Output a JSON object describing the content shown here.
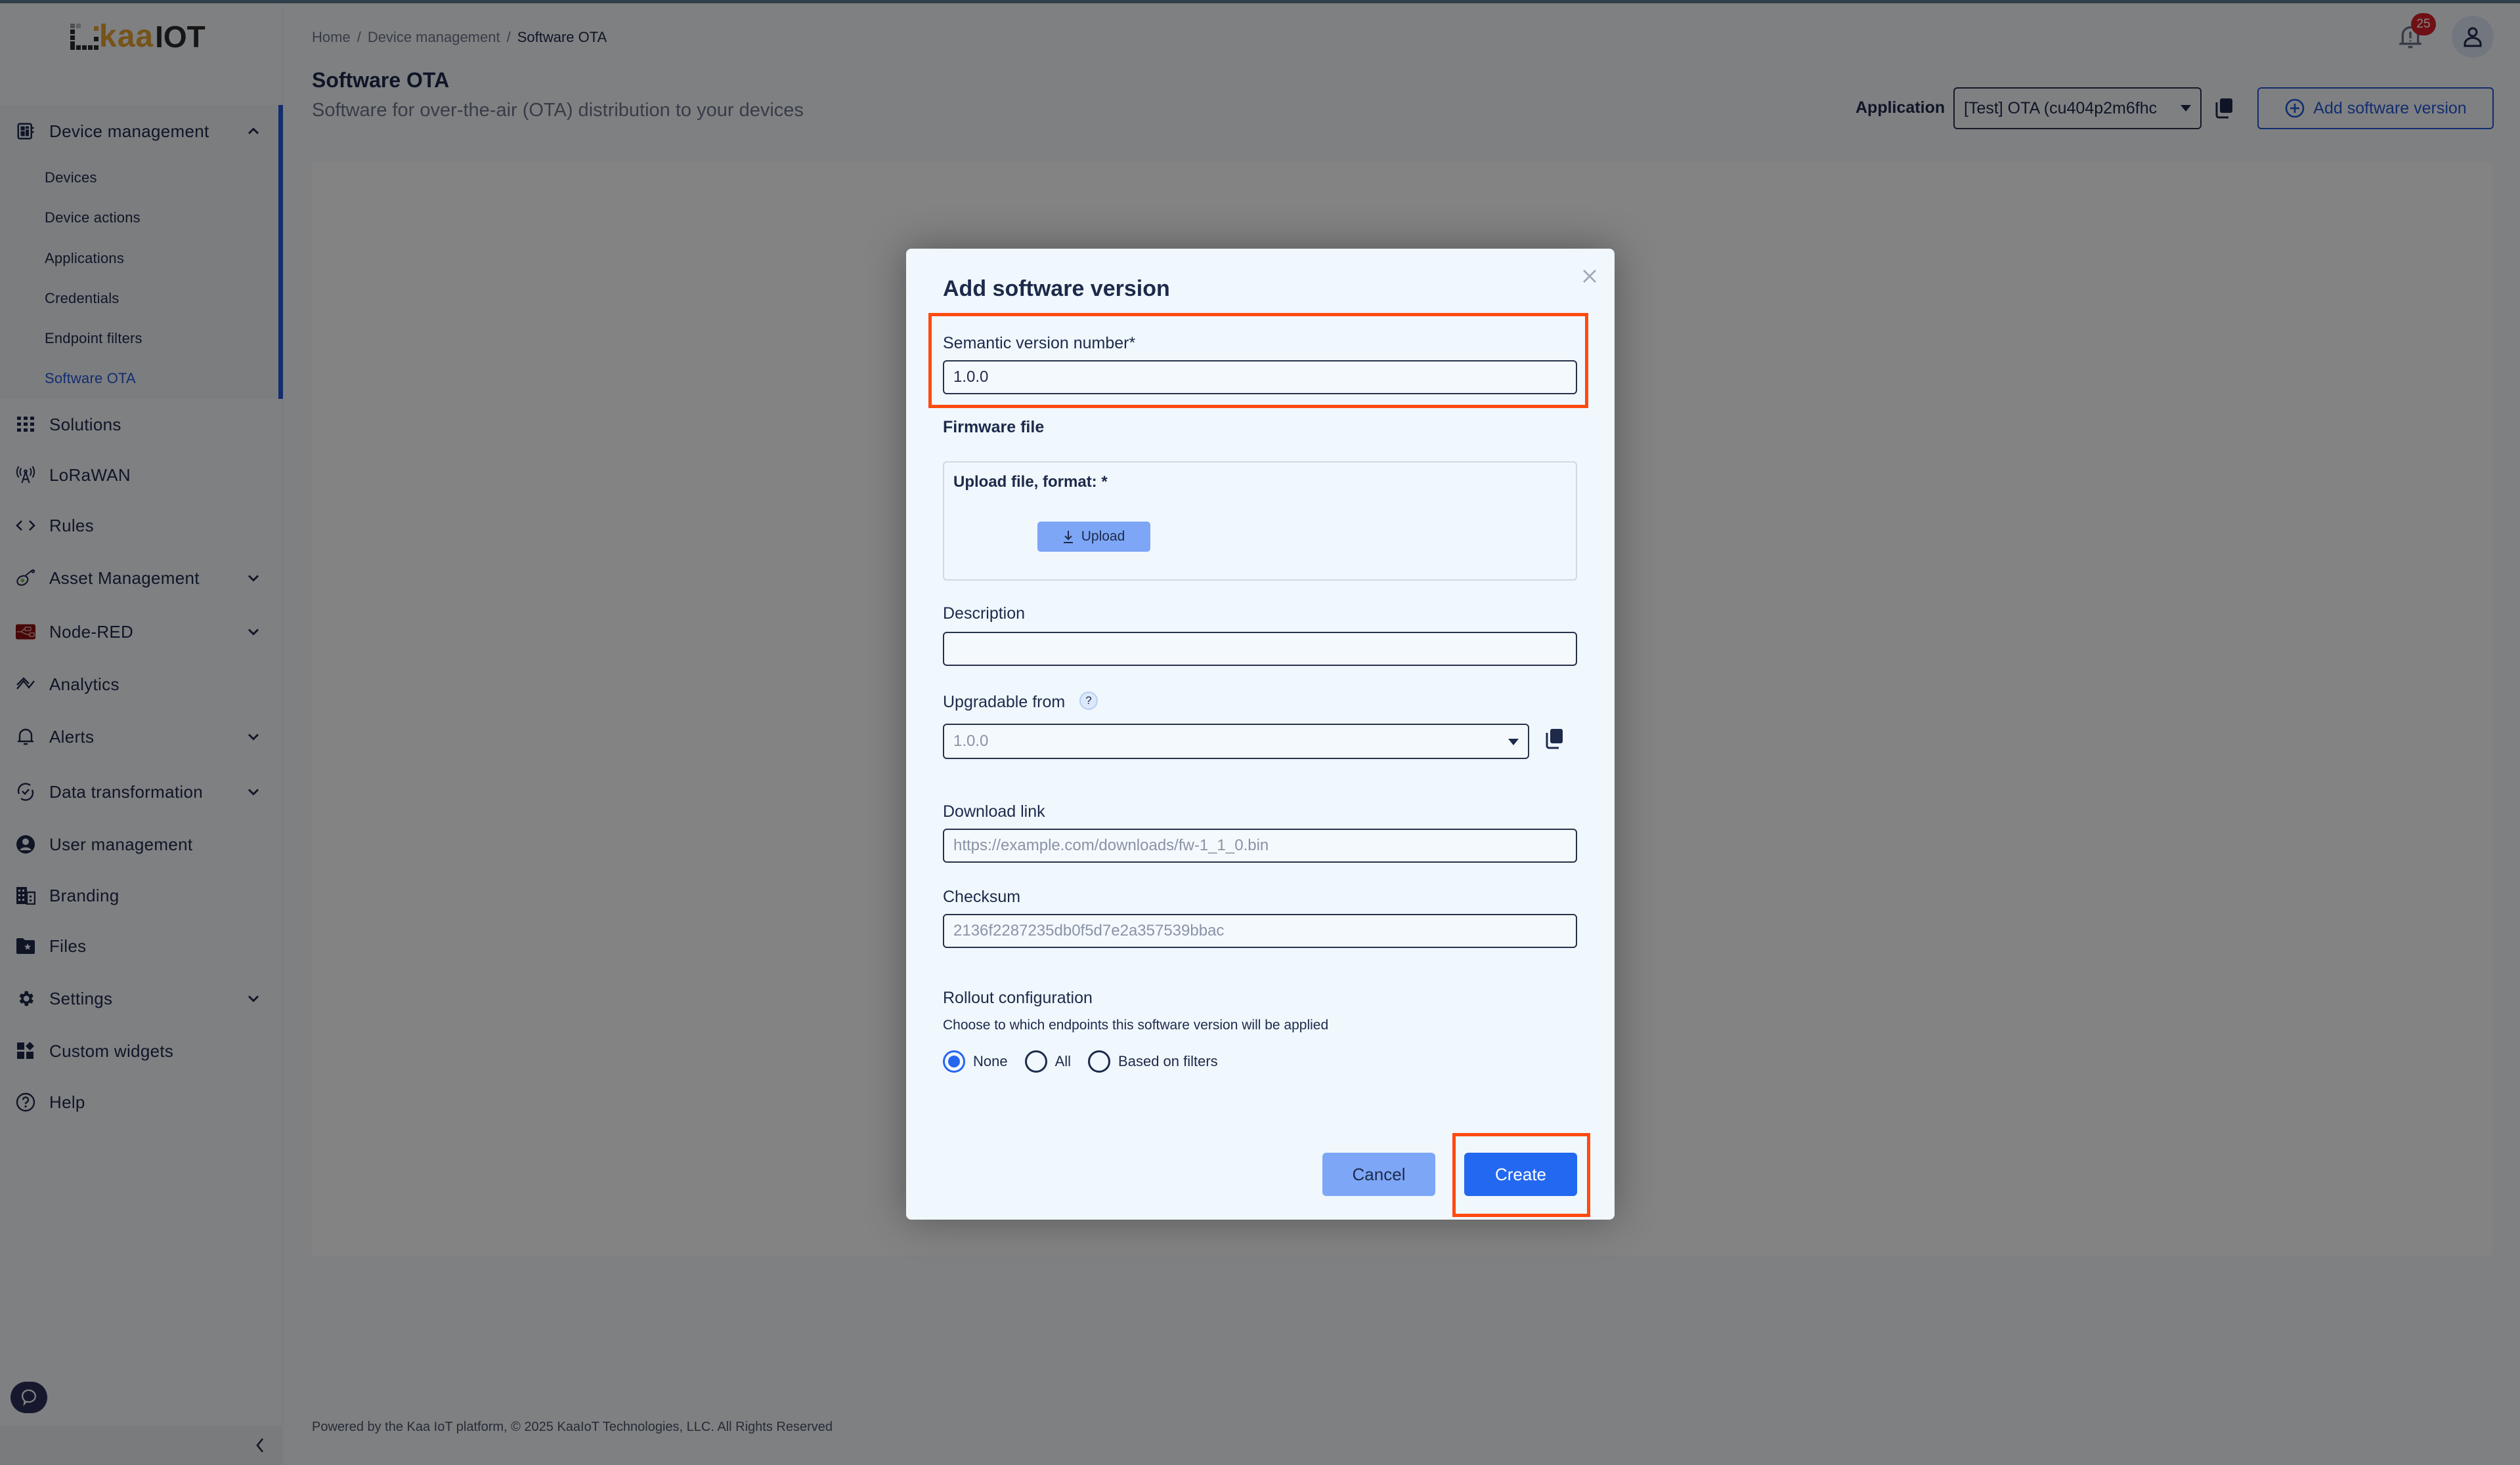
{
  "logo": {
    "brand_kaa": "kaa",
    "brand_iot": "IOT"
  },
  "sidebar": {
    "group": {
      "label": "Device management",
      "icon": "chip-icon",
      "expanded": true,
      "items": [
        {
          "label": "Devices",
          "active": false
        },
        {
          "label": "Device actions",
          "active": false
        },
        {
          "label": "Applications",
          "active": false
        },
        {
          "label": "Credentials",
          "active": false
        },
        {
          "label": "Endpoint filters",
          "active": false
        },
        {
          "label": "Software OTA",
          "active": true
        }
      ]
    },
    "items": [
      {
        "label": "Solutions",
        "icon": "grid-icon",
        "expandable": false
      },
      {
        "label": "LoRaWAN",
        "icon": "antenna-icon",
        "expandable": false
      },
      {
        "label": "Rules",
        "icon": "code-icon",
        "expandable": false
      },
      {
        "label": "Asset Management",
        "icon": "tag-icon",
        "expandable": true
      },
      {
        "label": "Node-RED",
        "icon": "node-red-icon",
        "expandable": true
      },
      {
        "label": "Analytics",
        "icon": "analytics-icon",
        "expandable": false
      },
      {
        "label": "Alerts",
        "icon": "bell-icon",
        "expandable": true
      },
      {
        "label": "Data transformation",
        "icon": "transform-icon",
        "expandable": true
      },
      {
        "label": "User management",
        "icon": "user-circle-icon",
        "expandable": false
      },
      {
        "label": "Branding",
        "icon": "building-icon",
        "expandable": false
      },
      {
        "label": "Files",
        "icon": "folder-star-icon",
        "expandable": false
      },
      {
        "label": "Settings",
        "icon": "gear-icon",
        "expandable": true
      },
      {
        "label": "Custom widgets",
        "icon": "widgets-icon",
        "expandable": false
      },
      {
        "label": "Help",
        "icon": "help-icon",
        "expandable": false
      }
    ]
  },
  "breadcrumb": {
    "items": [
      "Home",
      "Device management",
      "Software OTA"
    ],
    "separator": "/"
  },
  "header": {
    "title": "Software OTA",
    "subtitle": "Software for over-the-air (OTA) distribution to your devices",
    "notifications_count": "25",
    "application_label": "Application",
    "application_value": "[Test] OTA (cu404p2m6fhc",
    "add_button_label": "Add software version"
  },
  "modal": {
    "title": "Add software version",
    "semantic_version": {
      "label": "Semantic version number",
      "required_mark": "*",
      "value": "1.0.0"
    },
    "firmware_file": {
      "heading": "Firmware file",
      "upload_label": "Upload file, format: *",
      "upload_button": "Upload"
    },
    "description": {
      "label": "Description",
      "value": ""
    },
    "upgradable_from": {
      "label": "Upgradable from",
      "help": "?",
      "value": "1.0.0"
    },
    "download_link": {
      "label": "Download link",
      "placeholder": "https://example.com/downloads/fw-1_1_0.bin"
    },
    "checksum": {
      "label": "Checksum",
      "placeholder": "2136f2287235db0f5d7e2a357539bbac"
    },
    "rollout": {
      "label": "Rollout configuration",
      "hint": "Choose to which endpoints this software version will be applied",
      "options": [
        {
          "label": "None",
          "checked": true
        },
        {
          "label": "All",
          "checked": false
        },
        {
          "label": "Based on filters",
          "checked": false
        }
      ]
    },
    "cancel_label": "Cancel",
    "create_label": "Create"
  },
  "footer": {
    "text": "Powered by the Kaa IoT platform, © 2025 KaaIoT Technologies, LLC. All Rights Reserved"
  },
  "colors": {
    "accent": "#2456d6",
    "primary_button": "#2368f0",
    "secondary_button": "#7ea6f6",
    "highlight": "#ff4a10",
    "badge": "#d3202a",
    "logo_orange": "#e0a030"
  }
}
